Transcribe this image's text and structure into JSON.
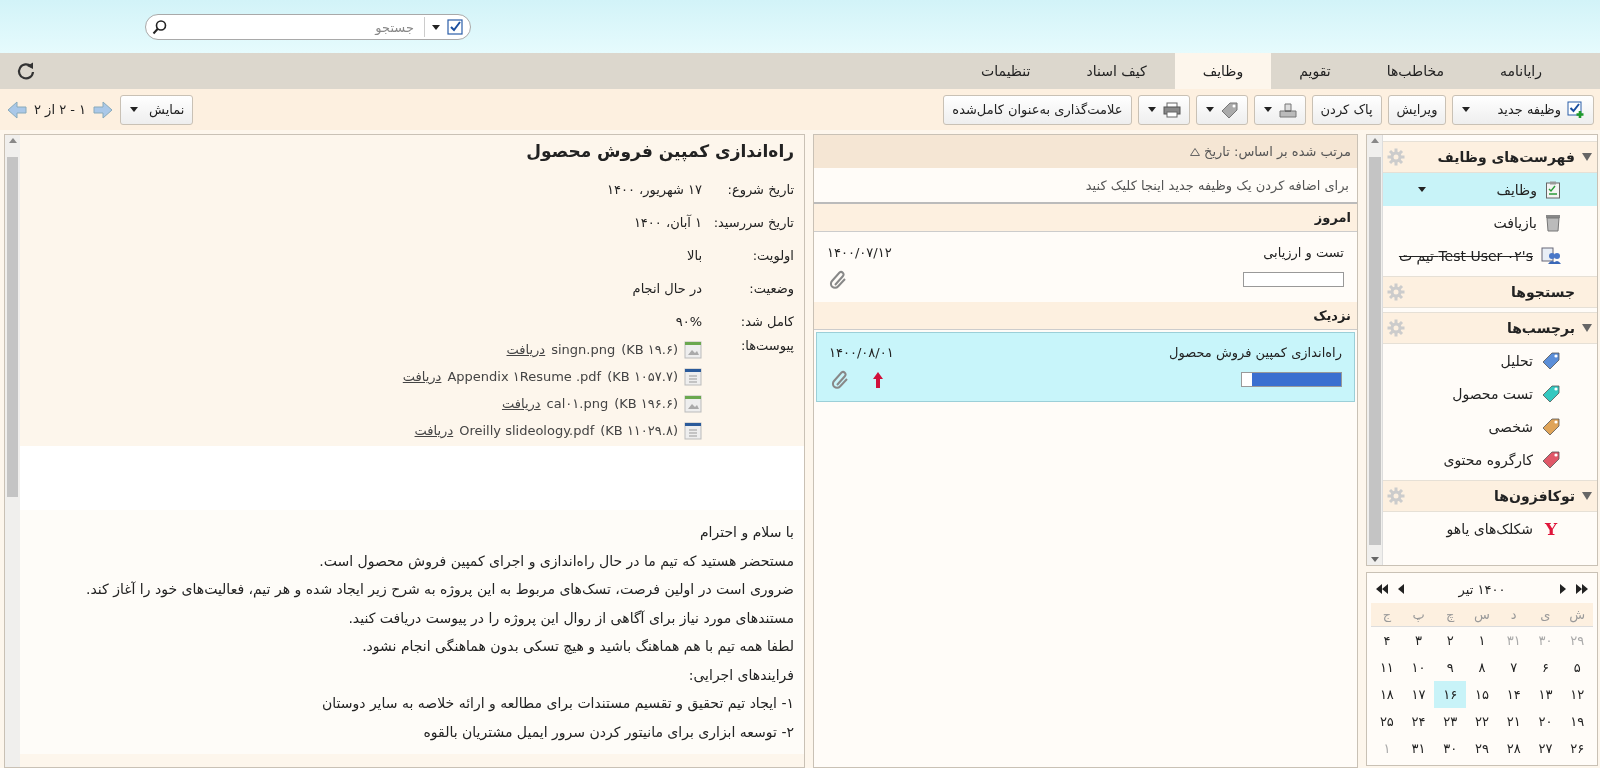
{
  "search": {
    "placeholder": "جستجو",
    "include_shared": true
  },
  "tabs": [
    {
      "label": "رایانامه",
      "selected": false
    },
    {
      "label": "مخاطب‌ها",
      "selected": false
    },
    {
      "label": "تقویم",
      "selected": false
    },
    {
      "label": "وظایف",
      "selected": true
    },
    {
      "label": "کیف اسناد",
      "selected": false
    },
    {
      "label": "تنظیمات",
      "selected": false
    }
  ],
  "toolbar": {
    "new_task": "وظیفه جدید",
    "edit": "ویرایش",
    "delete": "پاک کردن",
    "mark_complete": "علامت‌گذاری به‌عنوان کامل‌شده",
    "view": "نمایش",
    "page_info": "۱ - ۲ از ۲"
  },
  "sidebar": {
    "sections": [
      {
        "title": "فهرست‌های وظایف",
        "expandable": true,
        "items": [
          {
            "label": "وظایف",
            "kind": "tasks",
            "selected": true,
            "struck": false
          },
          {
            "label": "بازیافت",
            "kind": "trash",
            "selected": false,
            "struck": false
          },
          {
            "label": "Test User ۰۲'s تیم ت",
            "kind": "shared",
            "selected": false,
            "struck": true
          }
        ]
      },
      {
        "title": "جستجوها",
        "expandable": false
      },
      {
        "title": "برچسب‌ها",
        "expandable": true,
        "items": [
          {
            "label": "تحلیل",
            "kind": "tag",
            "color": "#5b8ed8",
            "selected": false,
            "struck": false
          },
          {
            "label": "تست محصول",
            "kind": "tag",
            "color": "#35c8c0",
            "selected": false,
            "struck": false
          },
          {
            "label": "شخصی",
            "kind": "tag",
            "color": "#e0a458",
            "selected": false,
            "struck": false
          },
          {
            "label": "کارگروه محتوی",
            "kind": "tag",
            "color": "#e05868",
            "selected": false,
            "struck": false
          }
        ]
      },
      {
        "title": "توکافزون‌ها",
        "expandable": true,
        "items": [
          {
            "label": "شکلک‌های یاهو",
            "kind": "letter",
            "icon_text": "Y",
            "selected": false,
            "struck": false
          }
        ]
      }
    ]
  },
  "calendar": {
    "title": "۱۴۰۰ تیر",
    "weekdays": [
      "ش",
      "ی",
      "د",
      "س",
      "چ",
      "پ",
      "ج"
    ],
    "weeks": [
      [
        {
          "day": "۲۹",
          "other_month": true,
          "selected": false
        },
        {
          "day": "۳۰",
          "other_month": true,
          "selected": false
        },
        {
          "day": "۳۱",
          "other_month": true,
          "selected": false
        },
        {
          "day": "۱",
          "other_month": false,
          "selected": false
        },
        {
          "day": "۲",
          "other_month": false,
          "selected": false
        },
        {
          "day": "۳",
          "other_month": false,
          "selected": false
        },
        {
          "day": "۴",
          "other_month": false,
          "selected": false
        }
      ],
      [
        {
          "day": "۵",
          "other_month": false,
          "selected": false
        },
        {
          "day": "۶",
          "other_month": false,
          "selected": false
        },
        {
          "day": "۷",
          "other_month": false,
          "selected": false
        },
        {
          "day": "۸",
          "other_month": false,
          "selected": false
        },
        {
          "day": "۹",
          "other_month": false,
          "selected": false
        },
        {
          "day": "۱۰",
          "other_month": false,
          "selected": false
        },
        {
          "day": "۱۱",
          "other_month": false,
          "selected": false
        }
      ],
      [
        {
          "day": "۱۲",
          "other_month": false,
          "selected": false
        },
        {
          "day": "۱۳",
          "other_month": false,
          "selected": false
        },
        {
          "day": "۱۴",
          "other_month": false,
          "selected": false
        },
        {
          "day": "۱۵",
          "other_month": false,
          "selected": false
        },
        {
          "day": "۱۶",
          "other_month": false,
          "selected": true
        },
        {
          "day": "۱۷",
          "other_month": false,
          "selected": false
        },
        {
          "day": "۱۸",
          "other_month": false,
          "selected": false
        }
      ],
      [
        {
          "day": "۱۹",
          "other_month": false,
          "selected": false
        },
        {
          "day": "۲۰",
          "other_month": false,
          "selected": false
        },
        {
          "day": "۲۱",
          "other_month": false,
          "selected": false
        },
        {
          "day": "۲۲",
          "other_month": false,
          "selected": false
        },
        {
          "day": "۲۳",
          "other_month": false,
          "selected": false
        },
        {
          "day": "۲۴",
          "other_month": false,
          "selected": false
        },
        {
          "day": "۲۵",
          "other_month": false,
          "selected": false
        }
      ],
      [
        {
          "day": "۲۶",
          "other_month": false,
          "selected": false
        },
        {
          "day": "۲۷",
          "other_month": false,
          "selected": false
        },
        {
          "day": "۲۸",
          "other_month": false,
          "selected": false
        },
        {
          "day": "۲۹",
          "other_month": false,
          "selected": false
        },
        {
          "day": "۳۰",
          "other_month": false,
          "selected": false
        },
        {
          "day": "۳۱",
          "other_month": false,
          "selected": false
        },
        {
          "day": "۱",
          "other_month": true,
          "selected": false
        }
      ]
    ]
  },
  "task_list": {
    "sort_label": "مرتب شده بر اساس: تاریخ",
    "add_hint": "برای اضافه کردن یک وظیفه جدید اینجا کلیک کنید",
    "groups": [
      {
        "title": "امروز",
        "tasks": [
          {
            "title": "تست  و ارزیابی",
            "date": "۱۴۰۰/۰۷/۱۲",
            "level": 0,
            "high_priority": false,
            "attachment": true,
            "selected": false
          }
        ]
      },
      {
        "title": "نزدیک",
        "tasks": [
          {
            "title": "راه‌اندازی کمپین فروش محصول",
            "date": "۱۴۰۰/۰۸/۰۱",
            "level": 0.9,
            "high_priority": true,
            "attachment": true,
            "selected": true
          }
        ]
      }
    ]
  },
  "detail": {
    "title": "راه‌اندازی کمپین فروش محصول",
    "fields": [
      {
        "label": "تاریخ شروع:",
        "value": "۱۷ شهریور، ۱۴۰۰"
      },
      {
        "label": "تاریخ سررسید:",
        "value": "۱ آبان، ۱۴۰۰"
      },
      {
        "label": "اولویت:",
        "value": "بالا"
      },
      {
        "label": "وضعیت:",
        "value": "در حال انجام"
      },
      {
        "label": "کامل شد:",
        "value": "۹۰%"
      }
    ],
    "attachments_label": "پیوست‌ها:",
    "attachments": [
      {
        "kind": "image",
        "name": "singn.png",
        "size": "(۱۹.۶ KB)",
        "link": "دریافت"
      },
      {
        "kind": "document",
        "name": "Appendix ۱Resume .pdf",
        "size": "(۱۰۵۷.۷ KB)",
        "link": "دریافت"
      },
      {
        "kind": "image",
        "name": "cal۰۱.png",
        "size": "(۱۹۶.۶ KB)",
        "link": "دریافت"
      },
      {
        "kind": "document",
        "name": "Oreilly slideology.pdf",
        "size": "(۱۱۰۲۹.۸ KB)",
        "link": "دریافت"
      }
    ],
    "body": [
      "با سلام و احترام",
      "مستحضر هستید که تیم ما در حال راه‌اندازی و اجرای کمپین فروش محصول است.",
      "ضروری است در اولین فرصت، تسک‌های مربوط به این پروژه به شرح زیر ایجاد شده و هر تیم، فعالیت‌های خود را آغاز کند.",
      "مستندهای مورد نیاز برای آگاهی از روال این پروژه را در پیوست دریافت کنید.",
      "لطفا همه تیم با هم هماهنگ باشید و هیچ تسکی بدون هماهنگی انجام نشود.",
      "فرایندهای اجرایی:",
      "۱-  ایجاد تیم تحقیق و تقسیم مستندات برای مطالعه و ارائه خلاصه به سایر دوستان",
      "۲- توسعه ابزاری برای مانیتور کردن سرور ایمیل مشتریان بالقوه"
    ]
  }
}
